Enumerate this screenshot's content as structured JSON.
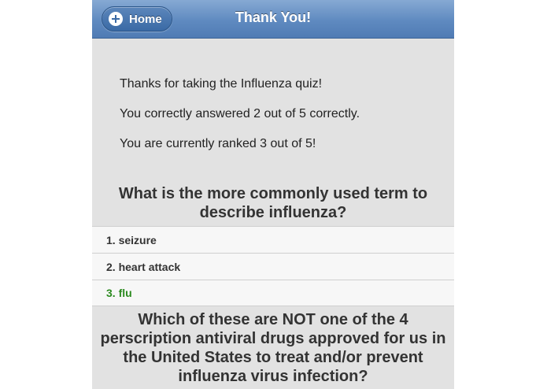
{
  "header": {
    "title": "Thank You!",
    "home_label": "Home",
    "home_icon": "plus-icon"
  },
  "results": {
    "line1": "Thanks for taking the Influenza quiz!",
    "line2": "You correctly answered 2 out of 5 correctly.",
    "line3": "You are currently ranked 3 out of 5!"
  },
  "questions": [
    {
      "text": "What is the more commonly used term to describe influenza?",
      "answers": [
        {
          "label": "1. seizure",
          "correct": false
        },
        {
          "label": "2. heart attack",
          "correct": false
        },
        {
          "label": "3. flu",
          "correct": true
        }
      ]
    },
    {
      "text": "Which of these are NOT one of the 4 perscription antiviral drugs approved for us in the United States to treat and/or prevent influenza virus infection?"
    }
  ],
  "colors": {
    "header_blue": "#5f8ac0",
    "correct_green": "#2b8a1f",
    "background_gray": "#e2e2e2"
  }
}
